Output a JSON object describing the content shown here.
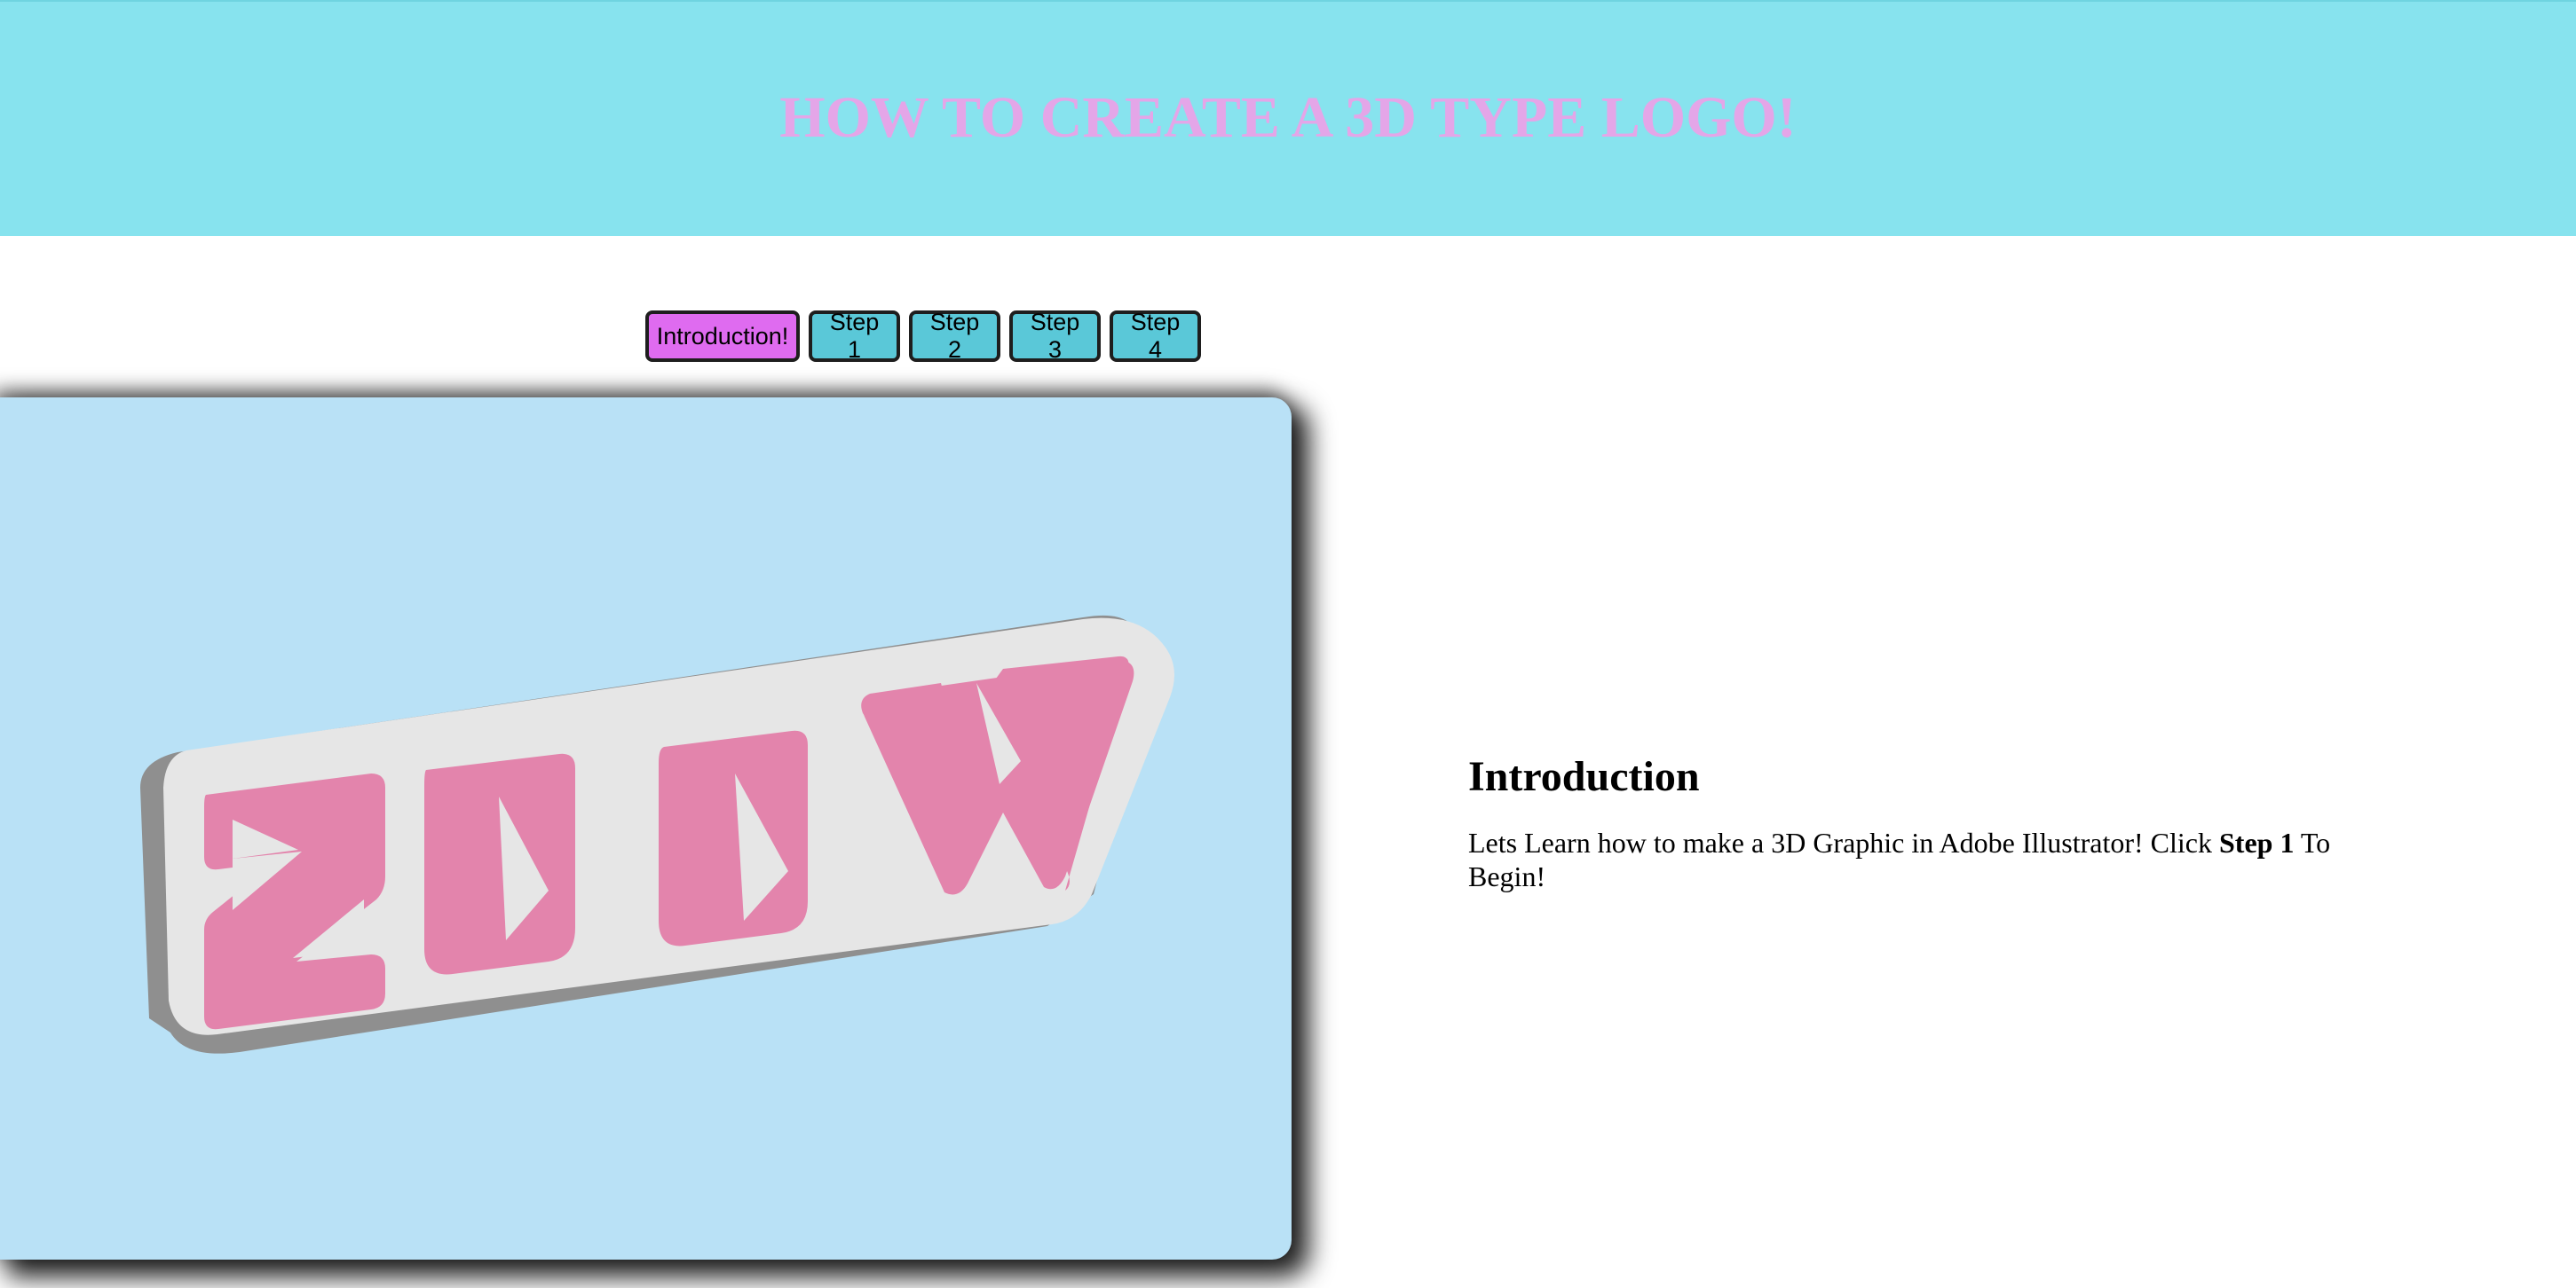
{
  "header": {
    "title": "HOW TO CREATE A 3D TYPE LOGO!"
  },
  "tabs": [
    {
      "label": "Introduction!",
      "active": true
    },
    {
      "label": "Step 1",
      "active": false
    },
    {
      "label": "Step 2",
      "active": false
    },
    {
      "label": "Step 3",
      "active": false
    },
    {
      "label": "Step 4",
      "active": false
    }
  ],
  "image": {
    "logo_text": "ZUUW",
    "colors": {
      "background": "#b9e1f6",
      "letters": "#e384ac",
      "outline": "#e6e6e6",
      "extrusion": "#8f8f8f"
    }
  },
  "content": {
    "heading": "Introduction",
    "body_prefix": "Lets Learn how to make a 3D Graphic in Adobe Illustrator! Click ",
    "body_bold": "Step 1",
    "body_suffix": " To Begin!"
  },
  "colors": {
    "header_bg": "#87e3ee",
    "header_text": "#e4a6e8",
    "tab_active": "#df6bf0",
    "tab_inactive": "#5ac8d8"
  }
}
